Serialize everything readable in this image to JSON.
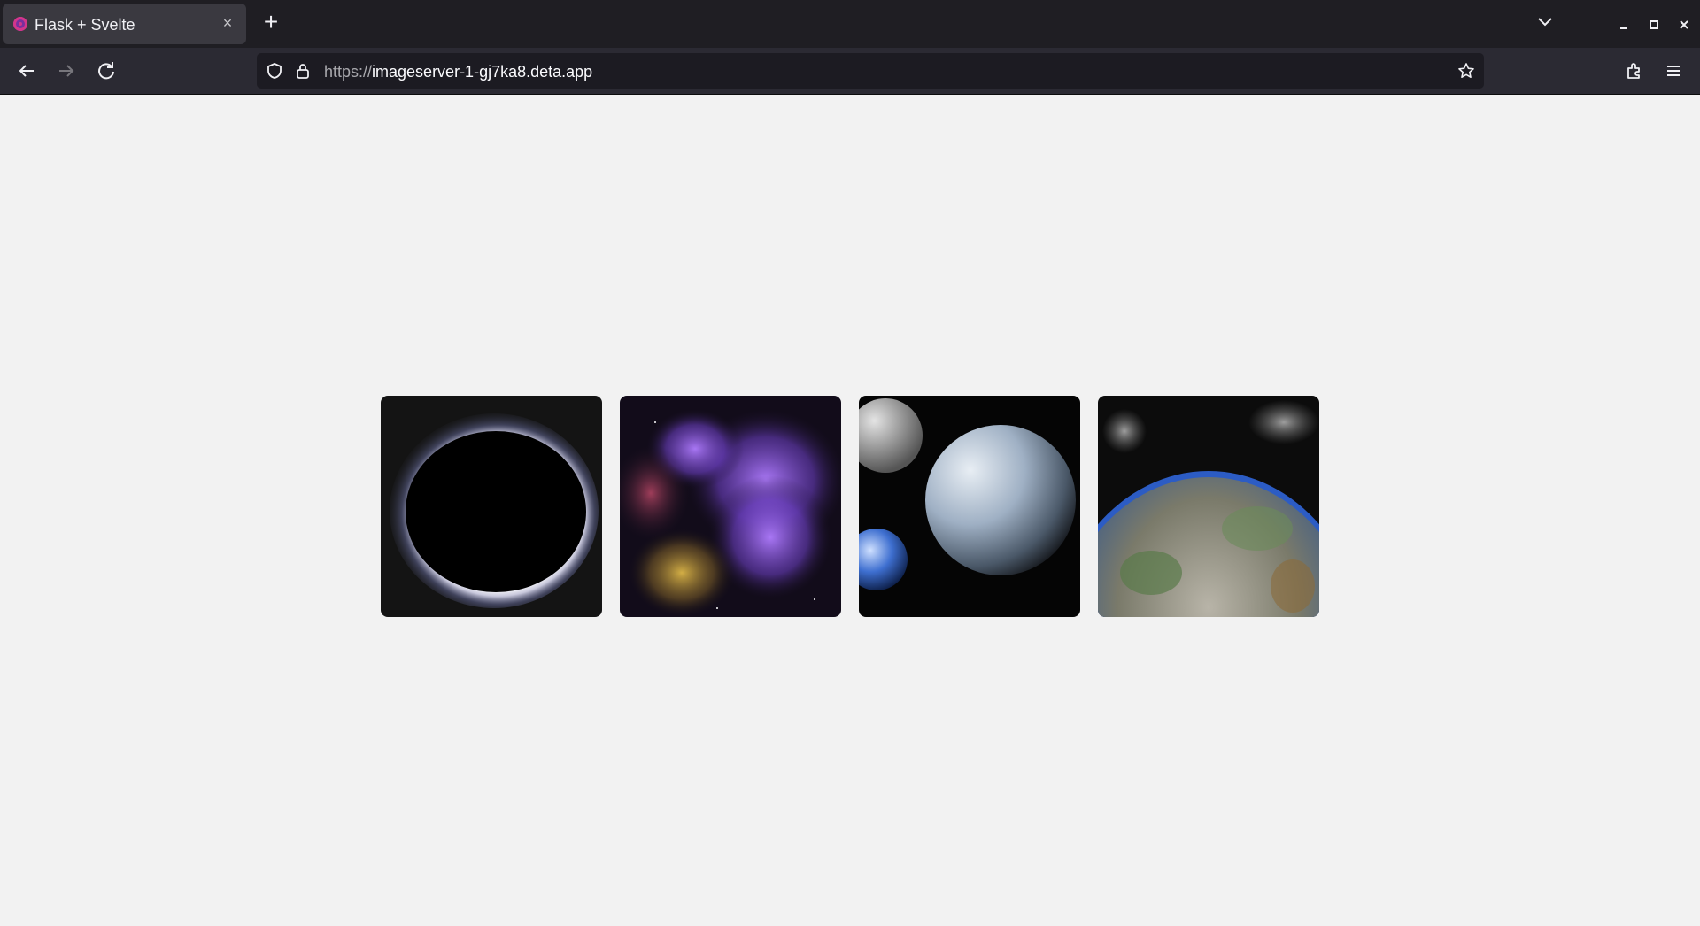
{
  "browser": {
    "tab": {
      "title": "Flask + Svelte",
      "close_glyph": "×",
      "favicon": "firefox-private-favicon-icon"
    },
    "new_tab_glyph": "+",
    "url": {
      "scheme": "https://",
      "host": "imageserver-1-gj7ka8.deta.app"
    }
  },
  "gallery": {
    "images": [
      {
        "alt_icon": "eclipse-image"
      },
      {
        "alt_icon": "purple-nebula-image"
      },
      {
        "alt_icon": "earth-and-moon-image"
      },
      {
        "alt_icon": "earth-from-space-image"
      }
    ]
  },
  "colors": {
    "page_background": "#f2f2f2",
    "tabbar": "#1f1e23",
    "navbar": "#2b2a33",
    "urlbar": "#1c1b22"
  }
}
